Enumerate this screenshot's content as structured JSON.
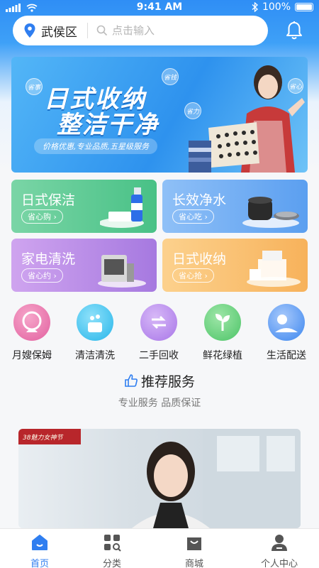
{
  "status_bar": {
    "time": "9:41 AM",
    "battery": "100%"
  },
  "search": {
    "location": "武侯区",
    "placeholder": "点击输入"
  },
  "banner": {
    "title_line1": "日式收纳",
    "title_line2": "整洁干净",
    "tagline": "价格优惠,专业品质,五星级服务",
    "bubbles": [
      "省事",
      "省钱",
      "省力",
      "省心"
    ]
  },
  "cards": [
    {
      "title": "日式保洁",
      "button": "省心购",
      "color_from": "#7ad5a6",
      "color_to": "#48c186"
    },
    {
      "title": "长效净水",
      "button": "省心吃",
      "color_from": "#8fc0f7",
      "color_to": "#5b9ff0"
    },
    {
      "title": "家电清洗",
      "button": "省心约",
      "color_from": "#cfa4ef",
      "color_to": "#a679e0"
    },
    {
      "title": "日式收纳",
      "button": "省心抢",
      "color_from": "#fcd18d",
      "color_to": "#f7b25b"
    }
  ],
  "services": [
    {
      "label": "月嫂保姆",
      "color": "#e2609f"
    },
    {
      "label": "清洁清洗",
      "color": "#27b6ea"
    },
    {
      "label": "二手回收",
      "color": "#a876e8"
    },
    {
      "label": "鲜花绿植",
      "color": "#4cc467"
    },
    {
      "label": "生活配送",
      "color": "#3b86ef"
    }
  ],
  "recommend": {
    "title": "推荐服务",
    "subtitle": "专业服务 品质保证"
  },
  "photo_badge": "38魅力女神节",
  "tabs": [
    {
      "label": "首页",
      "active": true
    },
    {
      "label": "分类",
      "active": false
    },
    {
      "label": "商城",
      "active": false
    },
    {
      "label": "个人中心",
      "active": false
    }
  ]
}
